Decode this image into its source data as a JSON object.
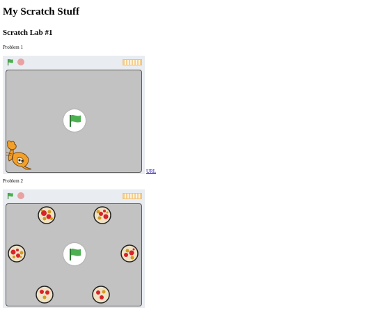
{
  "page": {
    "title": "My Scratch Stuff",
    "lab_title": "Scratch Lab #1"
  },
  "projects": [
    {
      "label": "Problem 1",
      "link_text": "URL",
      "controls": [
        "green-flag-icon",
        "stop-icon",
        "turbo-mode-icon"
      ],
      "sprite": "scratch-cat",
      "colors": {
        "stage": "#c2c2c2",
        "player_bar": "#e9edf2",
        "flag": "#4caf50",
        "stop": "#e8a2a2"
      }
    },
    {
      "label": "Problem 2",
      "controls": [
        "green-flag-icon",
        "stop-icon",
        "turbo-mode-icon"
      ],
      "sprite": "pizza",
      "colors": {
        "stage": "#c2c2c2",
        "pizza_sauce": "#d8232a",
        "pizza_cheese": "#d39b22"
      }
    }
  ]
}
